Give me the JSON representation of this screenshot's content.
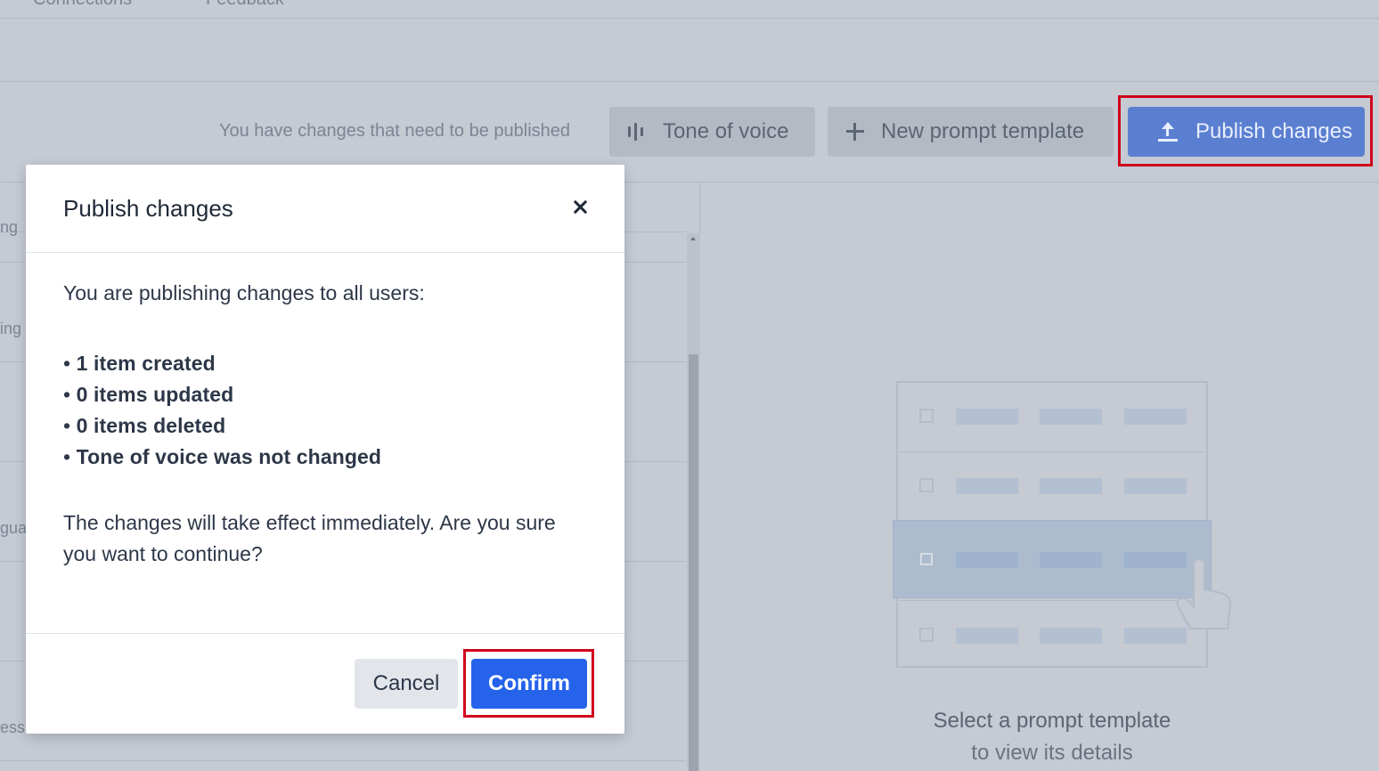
{
  "nav": {
    "tab_connections": "Connections",
    "tab_feedback": "Feedback"
  },
  "toolbar": {
    "pending_message": "You have changes that need to be published",
    "tone_label": "Tone of voice",
    "tone_icon": "waveform-icon",
    "new_template_label": "New prompt template",
    "new_template_icon": "plus-icon",
    "publish_label": "Publish changes",
    "publish_icon": "upload-icon"
  },
  "list": {
    "fragments": [
      "ng",
      "ing",
      "gua",
      "ess"
    ]
  },
  "empty_state": {
    "title": "Select a prompt template",
    "subtitle": "to view its details"
  },
  "modal": {
    "title": "Publish changes",
    "intro": "You are publishing changes to all users:",
    "changes": [
      "1 item created",
      "0 items updated",
      "0 items deleted",
      "Tone of voice was not changed"
    ],
    "warning": "The changes will take effect immediately. Are you sure you want to continue?",
    "cancel_label": "Cancel",
    "confirm_label": "Confirm"
  },
  "colors": {
    "primary": "#2563eb",
    "highlight": "#d0021b",
    "overlay": "#c5cad3"
  }
}
